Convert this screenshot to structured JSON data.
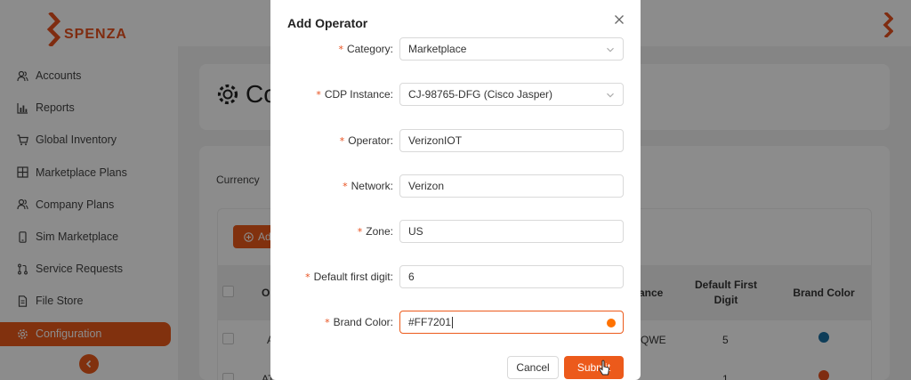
{
  "brand": {
    "name": "SPENZA",
    "accent": "#ec5a1b"
  },
  "sidebar": {
    "items": [
      {
        "label": "Accounts",
        "icon": "users-icon"
      },
      {
        "label": "Reports",
        "icon": "bar-chart-icon"
      },
      {
        "label": "Global Inventory",
        "icon": "cart-icon"
      },
      {
        "label": "Marketplace Plans",
        "icon": "grid-icon"
      },
      {
        "label": "Company Plans",
        "icon": "users-icon"
      },
      {
        "label": "Sim Marketplace",
        "icon": "phone-icon"
      },
      {
        "label": "Service Requests",
        "icon": "pull-request-icon"
      },
      {
        "label": "File Store",
        "icon": "file-icon"
      },
      {
        "label": "Configuration",
        "icon": "gear-icon",
        "active": true
      }
    ]
  },
  "page": {
    "title": "Co",
    "currency_label": "Currency",
    "add_button": "Ad"
  },
  "table": {
    "headers": {
      "col_operator": "Op",
      "col_instance": "ance",
      "col_first_digit": "Default First Digit",
      "col_brand_color": "Brand Color"
    },
    "rows": [
      {
        "operator": "A",
        "instance": "QWE",
        "first_digit": "5",
        "color": "#1a6fa3"
      },
      {
        "operator": "AT",
        "instance": "",
        "first_digit": "1",
        "color": "#e8501e"
      }
    ]
  },
  "modal": {
    "title": "Add Operator",
    "fields": {
      "category": {
        "label": "Category",
        "value": "Marketplace"
      },
      "cdp_instance": {
        "label": "CDP Instance",
        "value": "CJ-98765-DFG (Cisco Jasper)"
      },
      "operator": {
        "label": "Operator",
        "value": "VerizonIOT"
      },
      "network": {
        "label": "Network",
        "value": "Verizon"
      },
      "zone": {
        "label": "Zone",
        "value": "US"
      },
      "default_first_digit": {
        "label": "Default first digit",
        "value": "6"
      },
      "brand_color": {
        "label": "Brand Color",
        "value": "#FF7201",
        "swatch": "#FF7201"
      }
    },
    "cancel_label": "Cancel",
    "submit_label": "Submit"
  }
}
